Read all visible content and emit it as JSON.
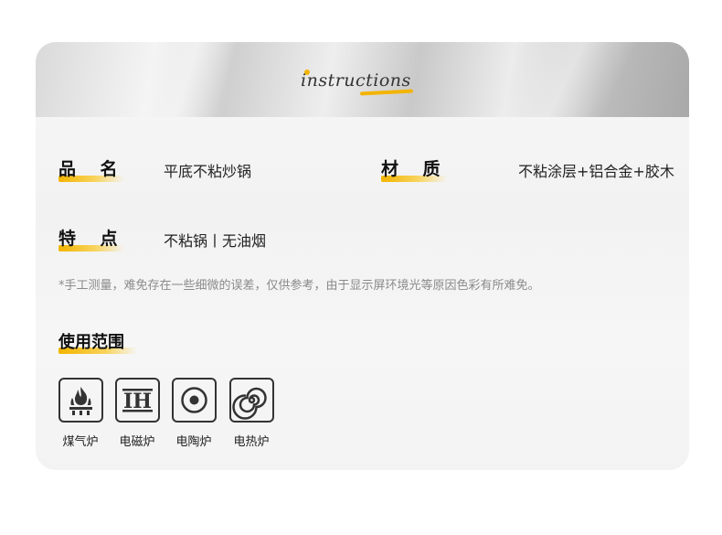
{
  "header": {
    "title": "instructions"
  },
  "specs": {
    "name_label": "品    名",
    "name_value": "平底不粘炒锅",
    "material_label": "材    质",
    "material_value": "不粘涂层+铝合金+胶木",
    "feature_label": "特    点",
    "feature_value": "不粘锅丨无油烟"
  },
  "note": "*手工测量，难免存在一些细微的误差，仅供参考，由于显示屏环境光等原因色彩有所难免。",
  "usage": {
    "title": "使用范围",
    "items": [
      {
        "label": "煤气炉",
        "icon": "gas-stove-icon"
      },
      {
        "label": "电磁炉",
        "icon": "induction-icon"
      },
      {
        "label": "电陶炉",
        "icon": "ceramic-stove-icon"
      },
      {
        "label": "电热炉",
        "icon": "electric-coil-icon"
      }
    ]
  },
  "colors": {
    "accent": "#f3b400",
    "text": "#111111",
    "note": "#8a8a8a"
  }
}
